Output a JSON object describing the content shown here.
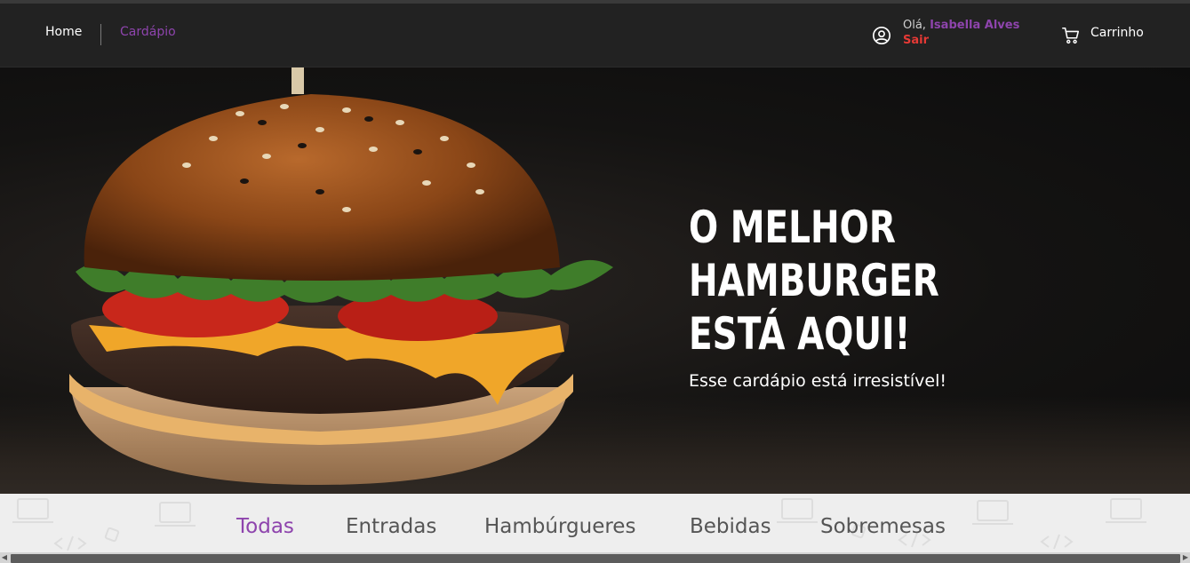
{
  "colors": {
    "accent": "#8e44ad",
    "logout": "#e53935",
    "header_bg": "#222222",
    "hero_title": "#ffffff"
  },
  "header": {
    "nav": {
      "home": "Home",
      "menu": "Cardápio"
    },
    "user": {
      "icon": "user-circle-icon",
      "greeting": "Olá,",
      "name": "Isabella Alves",
      "logout": "Sair"
    },
    "cart": {
      "icon": "cart-icon",
      "label": "Carrinho"
    }
  },
  "hero": {
    "title_lines": [
      "O MELHOR",
      "HAMBURGER",
      "ESTÁ AQUI!"
    ],
    "subtitle": "Esse cardápio está irresistível!"
  },
  "categories": {
    "items": [
      "Todas",
      "Entradas",
      "Hambúrgueres",
      "Bebidas",
      "Sobremesas"
    ],
    "active": "Todas"
  }
}
